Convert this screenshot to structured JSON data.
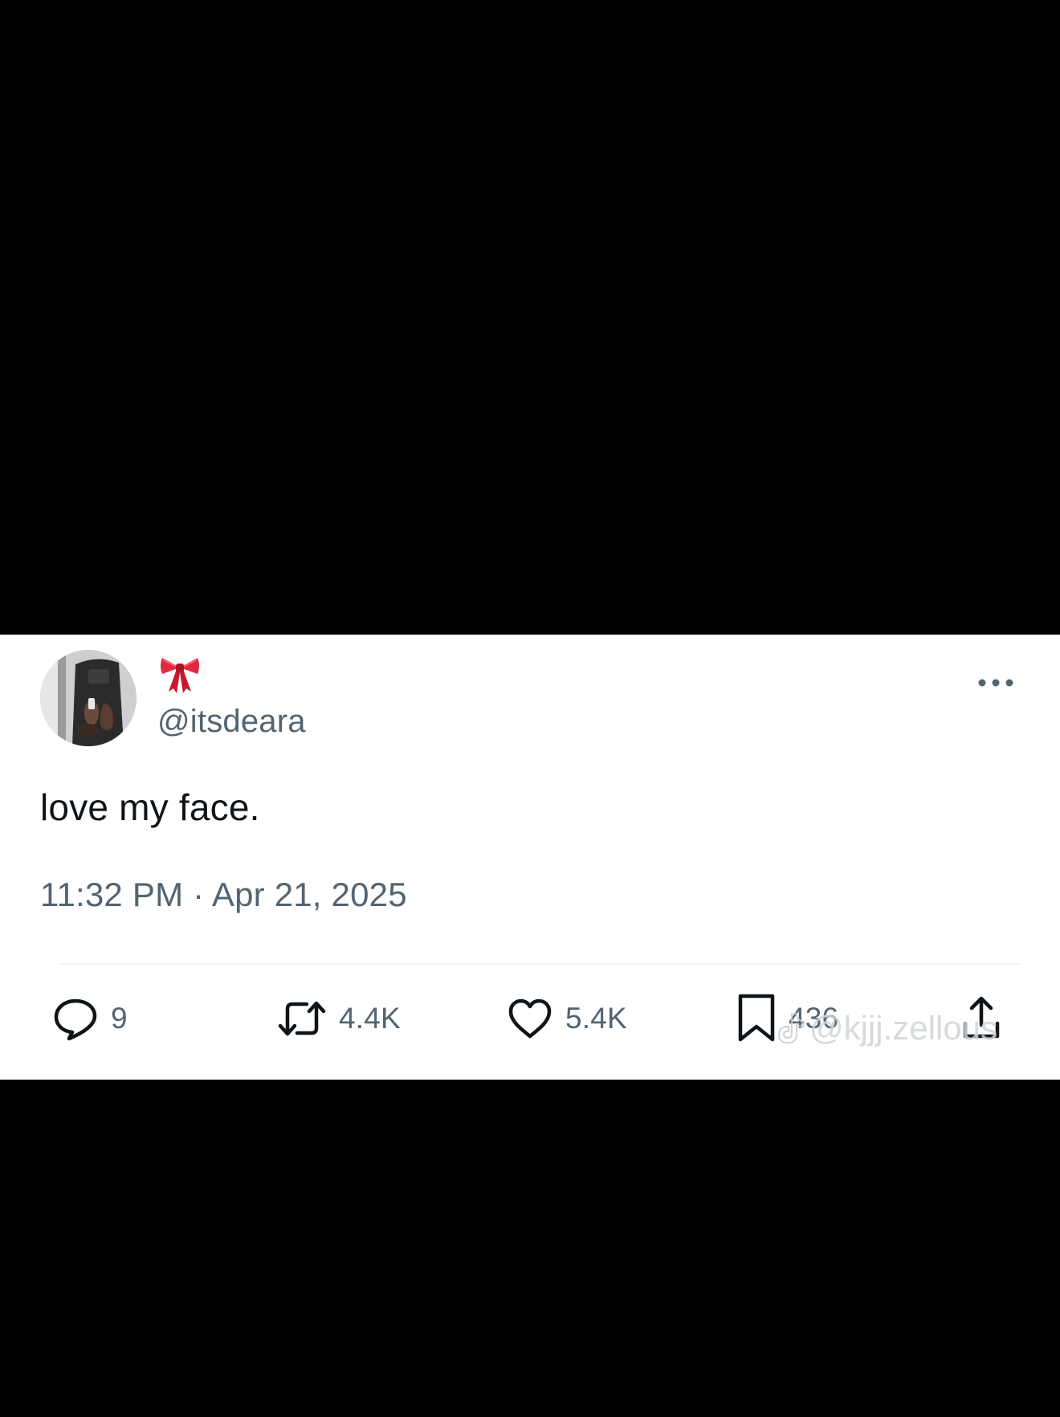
{
  "tweet": {
    "display_name_emoji": "🎀",
    "handle": "@itsdeara",
    "text": "love my face.",
    "timestamp": "11:32 PM · Apr 21, 2025",
    "more_icon": "more-horizontal-icon",
    "avatar_icon": "avatar-photo",
    "actions": {
      "reply": {
        "icon": "reply-bubble-icon",
        "count": "9"
      },
      "repost": {
        "icon": "repost-icon",
        "count": "4.4K"
      },
      "like": {
        "icon": "heart-icon",
        "count": "5.4K"
      },
      "bookmark": {
        "icon": "bookmark-icon",
        "count": "436"
      },
      "share": {
        "icon": "share-upload-icon"
      }
    }
  },
  "watermark": {
    "icon": "tiktok-logo-icon",
    "text": "@kjjj.zellous"
  },
  "colors": {
    "background_letterbox": "#000000",
    "card_background": "#ffffff",
    "primary_text": "#0f1419",
    "secondary_text": "#536471",
    "bow_red": "#e0283e",
    "divider": "#eff3f4"
  }
}
